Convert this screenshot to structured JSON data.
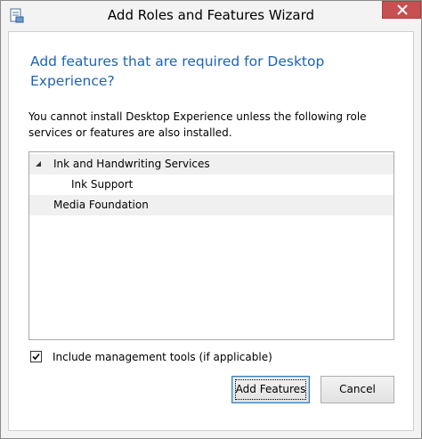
{
  "window": {
    "title": "Add Roles and Features Wizard"
  },
  "dialog": {
    "heading": "Add features that are required for Desktop Experience?",
    "description": "You cannot install Desktop Experience unless the following role services or features are also installed.",
    "tree": [
      {
        "label": "Ink and Handwriting Services",
        "expanded": true
      },
      {
        "label": "Ink Support"
      },
      {
        "label": "Media Foundation"
      }
    ],
    "include_tools": {
      "label": "Include management tools (if applicable)",
      "checked": true
    },
    "buttons": {
      "add_label": "Add Features",
      "cancel_label": "Cancel"
    }
  },
  "colors": {
    "heading": "#1e64b4",
    "close_button": "#c75050",
    "row_shade": "#f0f0f0"
  },
  "icons": {
    "app": "wizard-app-icon",
    "close": "close-icon",
    "expand": "collapse-triangle-icon",
    "check": "check-icon"
  }
}
